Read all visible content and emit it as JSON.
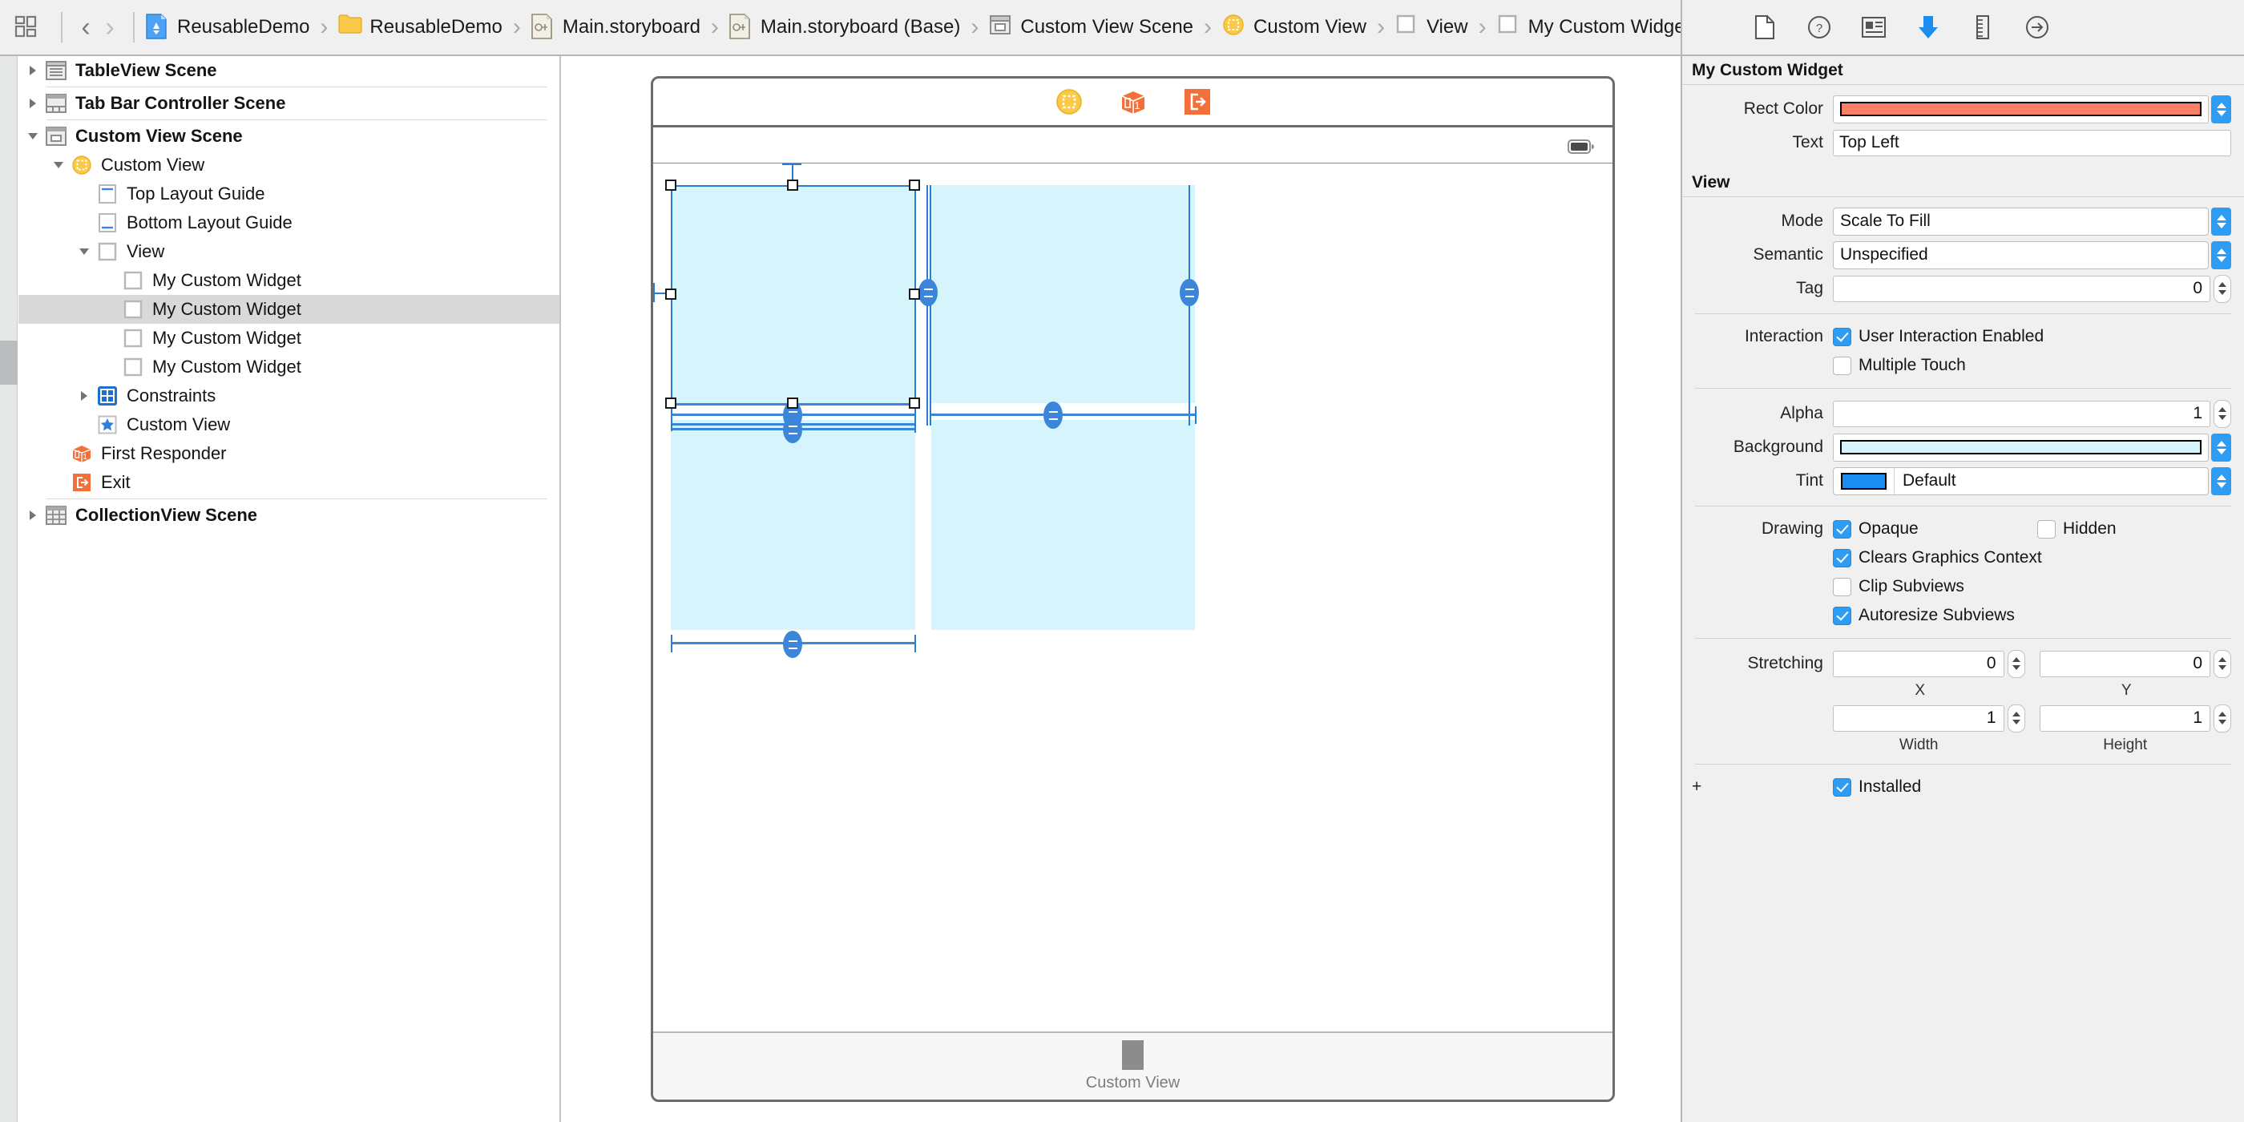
{
  "breadcrumb": {
    "jump_bar_icon": "jump-bar-icon",
    "back_label": "‹",
    "forward_label": "›",
    "items": [
      {
        "label": "ReusableDemo",
        "icon": "xcode-project-icon"
      },
      {
        "label": "ReusableDemo",
        "icon": "folder-icon"
      },
      {
        "label": "Main.storyboard",
        "icon": "storyboard-file-icon"
      },
      {
        "label": "Main.storyboard (Base)",
        "icon": "storyboard-file-icon"
      },
      {
        "label": "Custom View Scene",
        "icon": "scene-icon"
      },
      {
        "label": "Custom View",
        "icon": "view-controller-icon"
      },
      {
        "label": "View",
        "icon": "view-icon"
      },
      {
        "label": "My Custom Widget",
        "icon": "view-icon"
      }
    ],
    "separator": "›"
  },
  "inspector_tabs": [
    {
      "name": "file-inspector-tab",
      "icon": "file-icon",
      "selected": false
    },
    {
      "name": "quick-help-inspector-tab",
      "icon": "question-circle-icon",
      "selected": false
    },
    {
      "name": "identity-inspector-tab",
      "icon": "identity-card-icon",
      "selected": false
    },
    {
      "name": "attributes-inspector-tab",
      "icon": "down-arrow-icon",
      "selected": true
    },
    {
      "name": "size-inspector-tab",
      "icon": "ruler-icon",
      "selected": false
    },
    {
      "name": "connections-inspector-tab",
      "icon": "arrow-circle-icon",
      "selected": false
    }
  ],
  "outline": {
    "items": [
      {
        "label": "TableView Scene",
        "icon": "scene-table-icon",
        "indent": 0,
        "disclosure": "collapsed",
        "bold": true,
        "selected": false,
        "sep_after": true
      },
      {
        "label": "Tab Bar Controller Scene",
        "icon": "scene-tabbar-icon",
        "indent": 0,
        "disclosure": "collapsed",
        "bold": true,
        "selected": false,
        "sep_after": true
      },
      {
        "label": "Custom View Scene",
        "icon": "scene-view-icon",
        "indent": 0,
        "disclosure": "expanded",
        "bold": true,
        "selected": false,
        "sep_after": false
      },
      {
        "label": "Custom View",
        "icon": "view-controller-icon",
        "indent": 1,
        "disclosure": "expanded",
        "bold": false,
        "selected": false,
        "sep_after": false
      },
      {
        "label": "Top Layout Guide",
        "icon": "top-layout-guide-icon",
        "indent": 2,
        "disclosure": "none",
        "bold": false,
        "selected": false,
        "sep_after": false
      },
      {
        "label": "Bottom Layout Guide",
        "icon": "bottom-layout-guide-icon",
        "indent": 2,
        "disclosure": "none",
        "bold": false,
        "selected": false,
        "sep_after": false
      },
      {
        "label": "View",
        "icon": "view-icon",
        "indent": 2,
        "disclosure": "expanded",
        "bold": false,
        "selected": false,
        "sep_after": false
      },
      {
        "label": "My Custom Widget",
        "icon": "view-icon",
        "indent": 3,
        "disclosure": "none",
        "bold": false,
        "selected": false,
        "sep_after": false
      },
      {
        "label": "My Custom Widget",
        "icon": "view-icon",
        "indent": 3,
        "disclosure": "none",
        "bold": false,
        "selected": true,
        "sep_after": false
      },
      {
        "label": "My Custom Widget",
        "icon": "view-icon",
        "indent": 3,
        "disclosure": "none",
        "bold": false,
        "selected": false,
        "sep_after": false
      },
      {
        "label": "My Custom Widget",
        "icon": "view-icon",
        "indent": 3,
        "disclosure": "none",
        "bold": false,
        "selected": false,
        "sep_after": false
      },
      {
        "label": "Constraints",
        "icon": "constraints-icon",
        "indent": 2,
        "disclosure": "collapsed",
        "bold": false,
        "selected": false,
        "sep_after": false
      },
      {
        "label": "Custom View",
        "icon": "star-icon",
        "indent": 2,
        "disclosure": "none",
        "bold": false,
        "selected": false,
        "sep_after": false
      },
      {
        "label": "First Responder",
        "icon": "first-responder-icon",
        "indent": 1,
        "disclosure": "none",
        "bold": false,
        "selected": false,
        "sep_after": false
      },
      {
        "label": "Exit",
        "icon": "exit-icon",
        "indent": 1,
        "disclosure": "none",
        "bold": false,
        "selected": false,
        "sep_after": true
      },
      {
        "label": "CollectionView Scene",
        "icon": "scene-collection-icon",
        "indent": 0,
        "disclosure": "collapsed",
        "bold": true,
        "selected": false,
        "sep_after": false
      }
    ]
  },
  "canvas": {
    "dock_icons": [
      {
        "name": "view-controller-dock-icon"
      },
      {
        "name": "first-responder-dock-icon"
      },
      {
        "name": "exit-dock-icon"
      }
    ],
    "status_bar_icon": "battery-icon",
    "footer_label": "Custom View",
    "footer_icon": "custom-view-icon",
    "widget_fill_color": "#d5f4fb",
    "constraint_color": "#3b86d9"
  },
  "inspector": {
    "widget_section": {
      "title": "My Custom Widget",
      "rect_color": {
        "label": "Rect Color",
        "value_hex": "#fa7f68"
      },
      "text": {
        "label": "Text",
        "value": "Top Left",
        "placeholder": ""
      }
    },
    "view_section": {
      "title": "View",
      "mode": {
        "label": "Mode",
        "value": "Scale To Fill"
      },
      "semantic": {
        "label": "Semantic",
        "value": "Unspecified"
      },
      "tag": {
        "label": "Tag",
        "value": "0"
      },
      "interaction": {
        "label": "Interaction",
        "user_interaction_enabled": {
          "label": "User Interaction Enabled",
          "checked": true
        },
        "multiple_touch": {
          "label": "Multiple Touch",
          "checked": false
        }
      },
      "alpha": {
        "label": "Alpha",
        "value": "1"
      },
      "background": {
        "label": "Background",
        "value_hex": "#d5f4fb"
      },
      "tint": {
        "label": "Tint",
        "value": "Default",
        "chip_hex": "#1b8cf0"
      },
      "drawing": {
        "label": "Drawing",
        "opaque": {
          "label": "Opaque",
          "checked": true
        },
        "hidden": {
          "label": "Hidden",
          "checked": false
        },
        "clears_graphics_context": {
          "label": "Clears Graphics Context",
          "checked": true
        },
        "clip_subviews": {
          "label": "Clip Subviews",
          "checked": false
        },
        "autoresize_subviews": {
          "label": "Autoresize Subviews",
          "checked": true
        }
      },
      "stretching": {
        "label": "Stretching",
        "x": {
          "caption": "X",
          "value": "0"
        },
        "y": {
          "caption": "Y",
          "value": "0"
        },
        "width": {
          "caption": "Width",
          "value": "1"
        },
        "height": {
          "caption": "Height",
          "value": "1"
        }
      },
      "installed": {
        "label": "Installed",
        "checked": true,
        "add_label": "+"
      }
    }
  }
}
